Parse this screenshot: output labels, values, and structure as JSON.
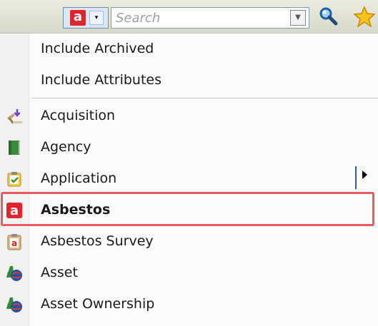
{
  "toolbar": {
    "type_selector": {
      "icon": "asbestos-a-icon",
      "letter": "a",
      "arrow": "▾"
    },
    "search": {
      "placeholder": "Search",
      "value": ""
    },
    "buttons": [
      {
        "name": "search-button",
        "icon": "magnifier-icon"
      },
      {
        "name": "favorites-button",
        "icon": "star-icon"
      }
    ]
  },
  "menu": {
    "options": [
      {
        "label": "Include Archived"
      },
      {
        "label": "Include Attributes"
      }
    ],
    "items": [
      {
        "label": "Acquisition",
        "icon": "acquisition-gavel-icon"
      },
      {
        "label": "Agency",
        "icon": "green-book-icon",
        "has_submenu": true
      },
      {
        "label": "Application",
        "icon": "application-clipboard-icon"
      },
      {
        "label": "Asbestos",
        "icon": "asbestos-a-icon",
        "highlighted": true,
        "icon_letter": "a"
      },
      {
        "label": "Asbestos Survey",
        "icon": "asbestos-survey-icon",
        "icon_letter": "a"
      },
      {
        "label": "Asset",
        "icon": "asset-globe-icon"
      },
      {
        "label": "Asset Ownership",
        "icon": "asset-globe-icon"
      }
    ]
  },
  "colors": {
    "asbestos_red": "#e0242b",
    "highlight_border": "#ea5a5e",
    "submenu_indicator": "#2a63b6"
  }
}
